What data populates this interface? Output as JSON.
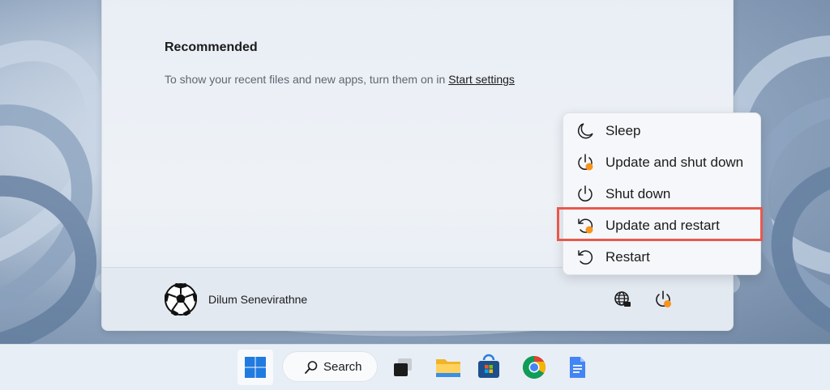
{
  "start_menu": {
    "recommended_title": "Recommended",
    "recommended_desc": "To show your recent files and new apps, turn them on in ",
    "recommended_link": "Start settings",
    "user_name": "Dilum Senevirathne"
  },
  "power_menu": {
    "items": [
      {
        "label": "Sleep",
        "icon": "moon-icon"
      },
      {
        "label": "Update and shut down",
        "icon": "power-update-icon"
      },
      {
        "label": "Shut down",
        "icon": "power-icon"
      },
      {
        "label": "Update and restart",
        "icon": "restart-update-icon"
      },
      {
        "label": "Restart",
        "icon": "restart-icon"
      }
    ],
    "highlighted_item": "Update and restart",
    "highlight_color": "#e8584c",
    "update_dot_color": "#f7941d"
  },
  "taskbar": {
    "search_label": "Search",
    "apps": [
      "windows-start-icon",
      "task-view-icon",
      "file-explorer-icon",
      "microsoft-store-icon",
      "chrome-icon",
      "google-docs-icon"
    ]
  }
}
